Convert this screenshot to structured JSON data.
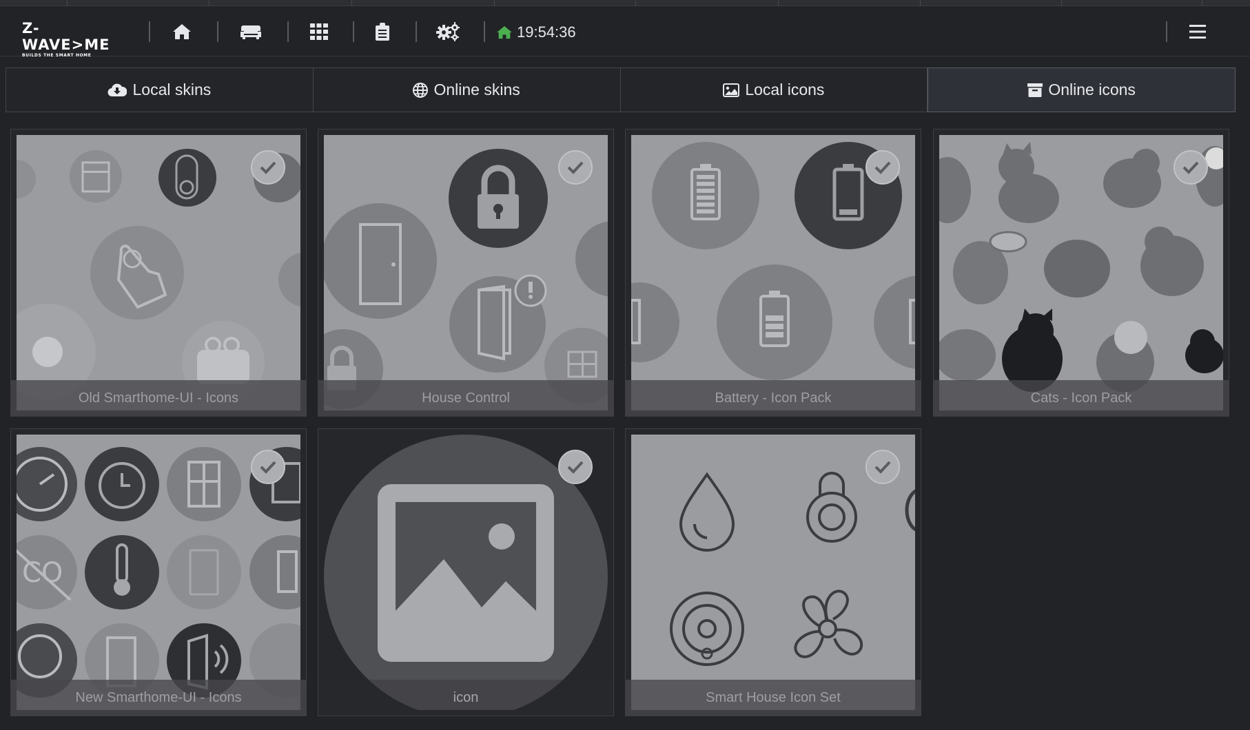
{
  "header": {
    "logo_text": "Z-WAVE>ME",
    "logo_tagline": "BUILDS THE SMART HOME",
    "clock": "19:54:36",
    "nav_icons": [
      "home-icon",
      "sofa-icon",
      "grid-icon",
      "clipboard-icon",
      "gears-icon"
    ],
    "menu_icon": "hamburger-icon"
  },
  "tabs": [
    {
      "label": "Local skins",
      "icon": "cloud-download-icon",
      "active": false
    },
    {
      "label": "Online skins",
      "icon": "globe-icon",
      "active": false
    },
    {
      "label": "Local icons",
      "icon": "image-icon",
      "active": false
    },
    {
      "label": "Online icons",
      "icon": "archive-icon",
      "active": true
    }
  ],
  "cards": [
    {
      "title": "Old Smarthome-UI - Icons",
      "checked": true
    },
    {
      "title": "House Control",
      "checked": true
    },
    {
      "title": "Battery - Icon Pack",
      "checked": true
    },
    {
      "title": "Cats - Icon Pack",
      "checked": true
    },
    {
      "title": "New Smarthome-UI - Icons",
      "checked": true
    },
    {
      "title": "icon",
      "checked": true
    },
    {
      "title": "Smart House Icon Set",
      "checked": true
    }
  ],
  "colors": {
    "background": "#222327",
    "tab_active": "#2f3138",
    "thumb_bg": "#9a9b9e",
    "clock_icon": "#4caf50"
  }
}
